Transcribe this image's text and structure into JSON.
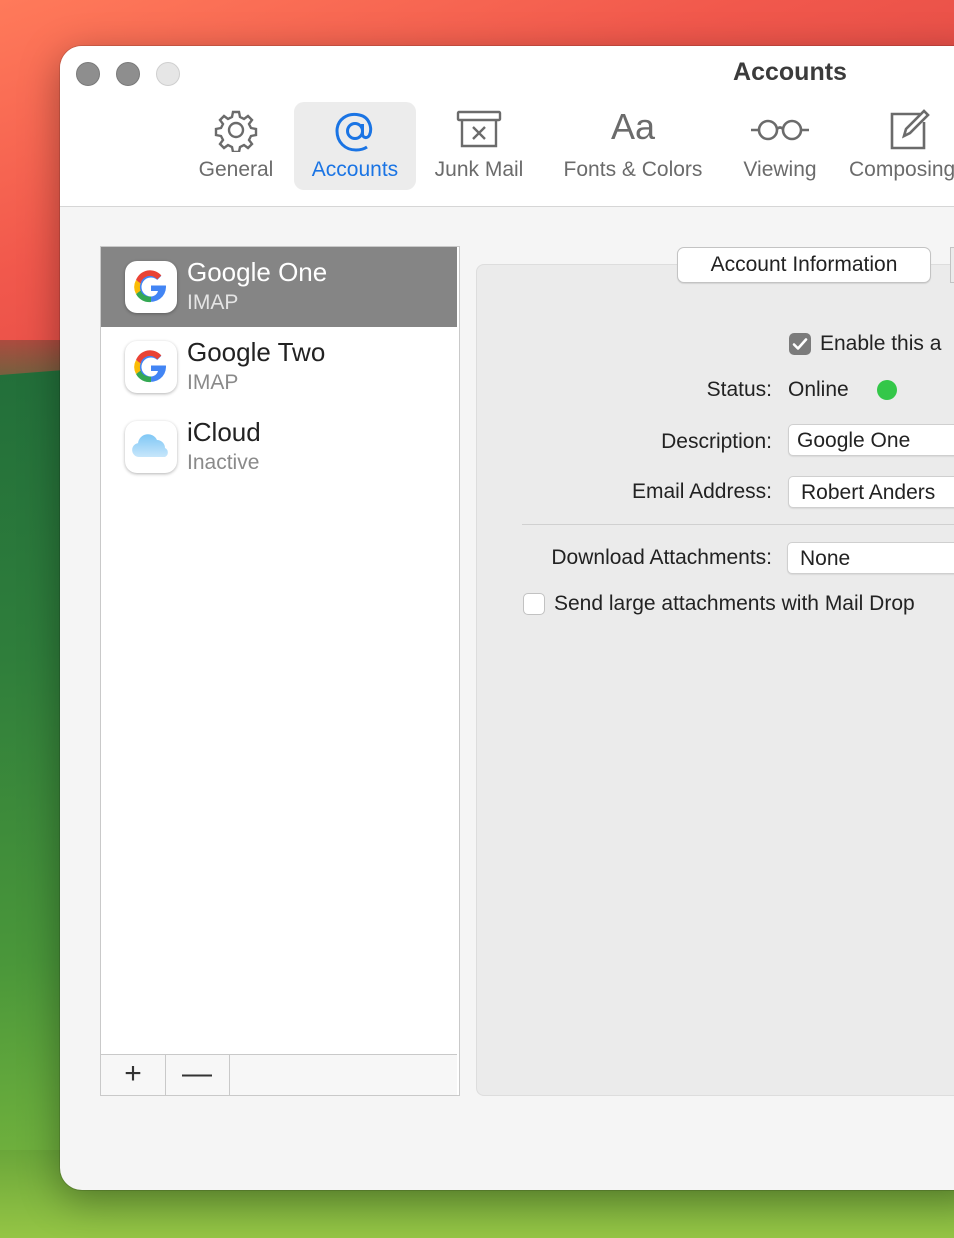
{
  "window": {
    "title": "Accounts"
  },
  "toolbar": {
    "tabs": [
      {
        "label": "General",
        "icon": "gear-icon"
      },
      {
        "label": "Accounts",
        "icon": "at-sign-icon",
        "active": true
      },
      {
        "label": "Junk Mail",
        "icon": "junk-trash-icon"
      },
      {
        "label": "Fonts & Colors",
        "icon": "font-aa-icon"
      },
      {
        "label": "Viewing",
        "icon": "glasses-icon"
      },
      {
        "label": "Composing",
        "icon": "compose-icon"
      }
    ]
  },
  "accounts": [
    {
      "name": "Google One",
      "type": "IMAP",
      "icon": "google-icon",
      "selected": true
    },
    {
      "name": "Google Two",
      "type": "IMAP",
      "icon": "google-icon"
    },
    {
      "name": "iCloud",
      "type": "Inactive",
      "icon": "icloud-icon"
    }
  ],
  "list_footer": {
    "add": "+",
    "remove": "—"
  },
  "detail": {
    "tab_label": "Account Information",
    "enable_label": "Enable this a",
    "enable_checked": true,
    "status_label": "Status:",
    "status_value": "Online",
    "status_color": "#34c749",
    "description_label": "Description:",
    "description_value": "Google One",
    "email_label": "Email Address:",
    "email_value": "Robert Anders",
    "download_label": "Download Attachments:",
    "download_value": "None",
    "maildrop_label": "Send large attachments with Mail Drop",
    "maildrop_checked": false
  },
  "colors": {
    "accent": "#1a74e4",
    "selection": "#858585"
  }
}
